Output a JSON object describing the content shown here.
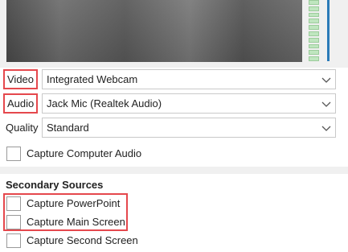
{
  "source": {
    "video": {
      "label": "Video",
      "value": "Integrated Webcam"
    },
    "audio": {
      "label": "Audio",
      "value": "Jack Mic (Realtek Audio)"
    },
    "quality": {
      "label": "Quality",
      "value": "Standard"
    }
  },
  "capture_computer_audio": {
    "label": "Capture Computer Audio",
    "checked": false
  },
  "secondary_sources": {
    "title": "Secondary Sources",
    "items": [
      {
        "label": "Capture PowerPoint",
        "checked": false
      },
      {
        "label": "Capture Main Screen",
        "checked": false
      },
      {
        "label": "Capture Second Screen",
        "checked": false
      }
    ]
  },
  "colors": {
    "highlight": "#e5484d",
    "meter_green": "#bfe6bf",
    "meter_blue": "#2a7ab8"
  },
  "icons": {
    "dropdown": "chevron-down-icon"
  }
}
